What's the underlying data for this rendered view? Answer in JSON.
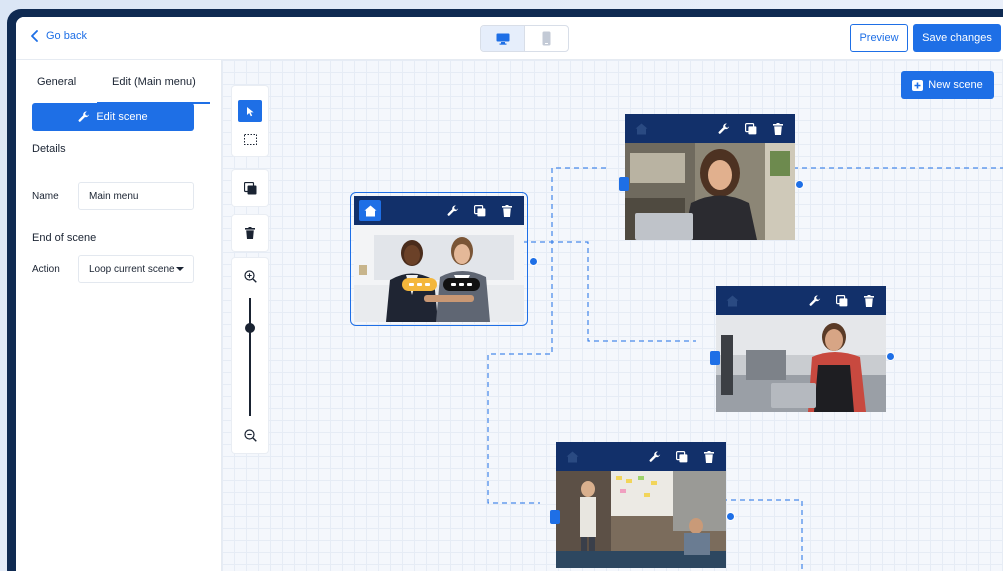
{
  "topbar": {
    "go_back_label": "Go back",
    "device_toggle": {
      "options": [
        "desktop",
        "mobile"
      ],
      "selected": "desktop"
    },
    "preview_label": "Preview",
    "save_label": "Save changes"
  },
  "left_panel": {
    "tabs": [
      {
        "label": "General",
        "active": false
      },
      {
        "label": "Edit (Main menu)",
        "active": true
      }
    ],
    "edit_scene_label": "Edit scene",
    "details_title": "Details",
    "name_label": "Name",
    "name_value": "Main menu",
    "end_of_scene_title": "End of scene",
    "action_label": "Action",
    "action_value": "Loop current scene"
  },
  "toolbar": {
    "tools": [
      "pointer-icon",
      "marquee-select-icon",
      "duplicate-icon",
      "trash-icon",
      "zoom-in-icon",
      "zoom-out-icon"
    ],
    "active_tool": "pointer-icon",
    "zoom_level_fraction": 0.75
  },
  "canvas": {
    "new_scene_label": "New scene",
    "scenes": [
      {
        "id": "main-menu",
        "is_start": true,
        "selected": true,
        "has_choice_buttons": true,
        "image": "two women smiling, arms crossed"
      },
      {
        "id": "scene-2",
        "is_start": false,
        "selected": false,
        "image": "woman on video call at laptop"
      },
      {
        "id": "scene-3",
        "is_start": false,
        "selected": false,
        "image": "man in apron at coffee shop with laptop"
      },
      {
        "id": "scene-4",
        "is_start": false,
        "selected": false,
        "image": "team meeting with whiteboard"
      }
    ]
  },
  "colors": {
    "accent": "#1e6fe6",
    "scene_bar": "#12306a",
    "frame": "#0f2a52",
    "choice_1": "#f4b73c",
    "choice_2": "#111111"
  }
}
